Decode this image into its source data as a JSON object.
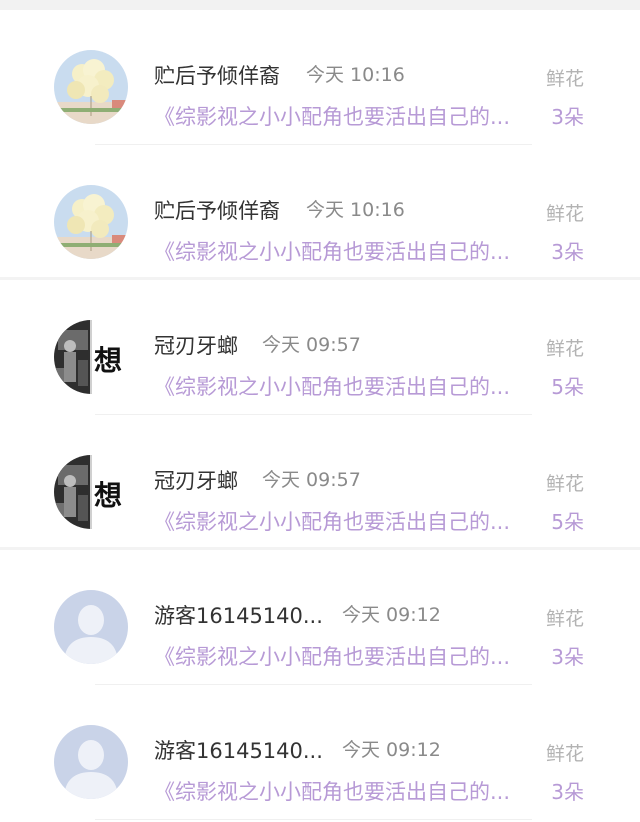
{
  "items": [
    {
      "name": "贮后予倾佯裔",
      "time": "今天 10:16",
      "message": "《综影视之小小配角也要活出自己的...",
      "flower_label": "鲜花",
      "flower_count": "3朵",
      "avatar": "balloons-avatar"
    },
    {
      "name": "贮后予倾佯裔",
      "time": "今天 10:16",
      "message": "《综影视之小小配角也要活出自己的...",
      "flower_label": "鲜花",
      "flower_count": "3朵",
      "avatar": "balloons-avatar"
    },
    {
      "name": "冠刃牙螂",
      "time": "今天 09:57",
      "message": "《综影视之小小配角也要活出自己的...",
      "flower_label": "鲜花",
      "flower_count": "5朵",
      "avatar": "monochrome-photo-avatar",
      "avatar_text": "想"
    },
    {
      "name": "冠刃牙螂",
      "time": "今天 09:57",
      "message": "《综影视之小小配角也要活出自己的...",
      "flower_label": "鲜花",
      "flower_count": "5朵",
      "avatar": "monochrome-photo-avatar",
      "avatar_text": "想"
    },
    {
      "name": "游客16145140...",
      "time": "今天 09:12",
      "message": "《综影视之小小配角也要活出自己的...",
      "flower_label": "鲜花",
      "flower_count": "3朵",
      "avatar": "default-user-avatar"
    },
    {
      "name": "游客16145140...",
      "time": "今天 09:12",
      "message": "《综影视之小小配角也要活出自己的...",
      "flower_label": "鲜花",
      "flower_count": "3朵",
      "avatar": "default-user-avatar"
    }
  ],
  "colors": {
    "accent_purple": "#b79ad6",
    "name_text": "#333333",
    "time_text": "#8a8a8a",
    "label_gray": "#b3b3b3"
  }
}
